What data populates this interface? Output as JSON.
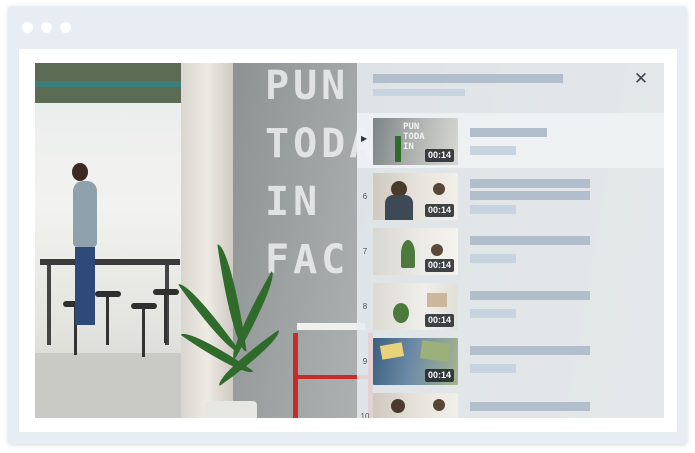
{
  "colors": {
    "browser_frame": "#e8edf4",
    "overlay": "#e8ecef",
    "placeholder_dark": "#b2becb",
    "placeholder_light": "#c7d4e0",
    "duration_badge": "#1e2328"
  },
  "window": {
    "controls": [
      "window-dot",
      "window-dot",
      "window-dot"
    ]
  },
  "player": {
    "background_wall_text": [
      "PUN",
      "TODA",
      "IN",
      "FAC"
    ],
    "playlist": {
      "close_icon": "✕",
      "play_indicator": "▶",
      "items": [
        {
          "index": "",
          "duration": "00:14",
          "active": true
        },
        {
          "index": "6",
          "duration": "00:14",
          "active": false
        },
        {
          "index": "7",
          "duration": "00:14",
          "active": false
        },
        {
          "index": "8",
          "duration": "00:14",
          "active": false
        },
        {
          "index": "9",
          "duration": "00:14",
          "active": false
        },
        {
          "index": "10",
          "duration": "",
          "active": false
        }
      ]
    }
  }
}
